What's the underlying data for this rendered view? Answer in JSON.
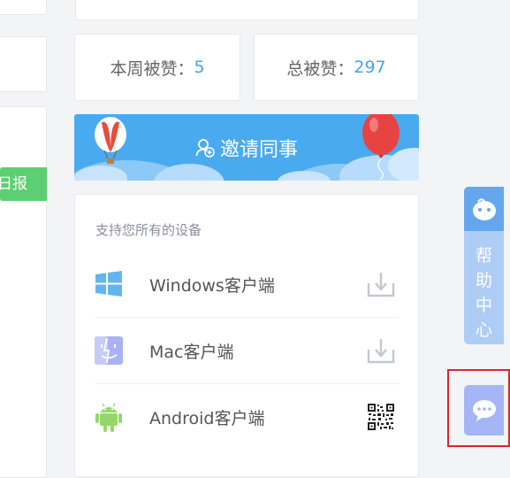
{
  "left_panel": {
    "daily_report_label": "日报"
  },
  "stats": {
    "week_label": "本周被赞：",
    "week_value": "5",
    "total_label": "总被赞：",
    "total_value": "297"
  },
  "invite": {
    "label": "邀请同事",
    "icon": "user-add-icon"
  },
  "devices": {
    "title": "支持您所有的设备",
    "items": [
      {
        "label": "Windows客户端",
        "icon": "windows-icon",
        "action_icon": "download-icon"
      },
      {
        "label": "Mac客户端",
        "icon": "mac-icon",
        "action_icon": "download-icon"
      },
      {
        "label": "Android客户端",
        "icon": "android-icon",
        "action_icon": "qr-code-icon"
      }
    ]
  },
  "help_tab": {
    "text": "帮助中心",
    "icon": "robot-icon"
  },
  "chat": {
    "icon": "chat-bubble-icon"
  },
  "colors": {
    "accent_blue": "#42a5f5",
    "green": "#5dcf73",
    "banner_blue": "#4aaaf0",
    "help_blue": "#aecdf6",
    "chat_purple": "#a5b6f7",
    "highlight_red": "#d9262c"
  }
}
